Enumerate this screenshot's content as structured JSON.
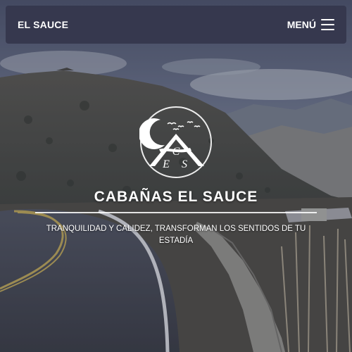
{
  "navbar": {
    "brand": "EL SAUCE",
    "menu_label": "MENÚ",
    "menu_icon": "hamburger-icon"
  },
  "hero": {
    "logo_letters": [
      "C",
      "E",
      "S"
    ],
    "title": "CABAÑAS EL SAUCE",
    "tagline": "TRANQUILIDAD Y CALIDEZ, TRANSFORMAN LOS SENTIDOS DE TU ESTADÍA"
  },
  "colors": {
    "navbar_bg": "#35374d",
    "text": "#ffffff"
  }
}
